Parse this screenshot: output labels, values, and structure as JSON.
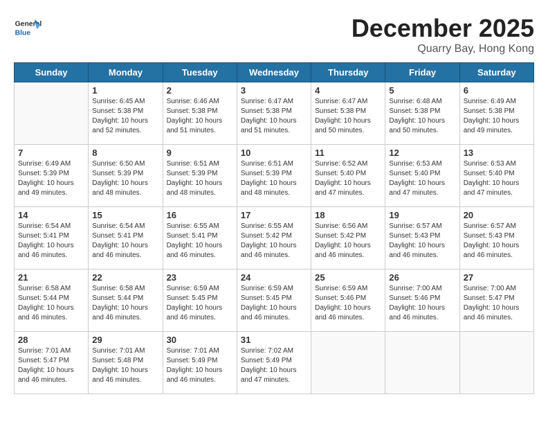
{
  "header": {
    "logo_general": "General",
    "logo_blue": "Blue",
    "month_title": "December 2025",
    "subtitle": "Quarry Bay, Hong Kong"
  },
  "weekdays": [
    "Sunday",
    "Monday",
    "Tuesday",
    "Wednesday",
    "Thursday",
    "Friday",
    "Saturday"
  ],
  "weeks": [
    [
      {
        "day": "",
        "empty": true
      },
      {
        "day": "1",
        "rise": "6:45 AM",
        "set": "5:38 PM",
        "daylight": "10 hours and 52 minutes."
      },
      {
        "day": "2",
        "rise": "6:46 AM",
        "set": "5:38 PM",
        "daylight": "10 hours and 51 minutes."
      },
      {
        "day": "3",
        "rise": "6:47 AM",
        "set": "5:38 PM",
        "daylight": "10 hours and 51 minutes."
      },
      {
        "day": "4",
        "rise": "6:47 AM",
        "set": "5:38 PM",
        "daylight": "10 hours and 50 minutes."
      },
      {
        "day": "5",
        "rise": "6:48 AM",
        "set": "5:38 PM",
        "daylight": "10 hours and 50 minutes."
      },
      {
        "day": "6",
        "rise": "6:49 AM",
        "set": "5:38 PM",
        "daylight": "10 hours and 49 minutes."
      }
    ],
    [
      {
        "day": "7",
        "rise": "6:49 AM",
        "set": "5:39 PM",
        "daylight": "10 hours and 49 minutes."
      },
      {
        "day": "8",
        "rise": "6:50 AM",
        "set": "5:39 PM",
        "daylight": "10 hours and 48 minutes."
      },
      {
        "day": "9",
        "rise": "6:51 AM",
        "set": "5:39 PM",
        "daylight": "10 hours and 48 minutes."
      },
      {
        "day": "10",
        "rise": "6:51 AM",
        "set": "5:39 PM",
        "daylight": "10 hours and 48 minutes."
      },
      {
        "day": "11",
        "rise": "6:52 AM",
        "set": "5:40 PM",
        "daylight": "10 hours and 47 minutes."
      },
      {
        "day": "12",
        "rise": "6:53 AM",
        "set": "5:40 PM",
        "daylight": "10 hours and 47 minutes."
      },
      {
        "day": "13",
        "rise": "6:53 AM",
        "set": "5:40 PM",
        "daylight": "10 hours and 47 minutes."
      }
    ],
    [
      {
        "day": "14",
        "rise": "6:54 AM",
        "set": "5:41 PM",
        "daylight": "10 hours and 46 minutes."
      },
      {
        "day": "15",
        "rise": "6:54 AM",
        "set": "5:41 PM",
        "daylight": "10 hours and 46 minutes."
      },
      {
        "day": "16",
        "rise": "6:55 AM",
        "set": "5:41 PM",
        "daylight": "10 hours and 46 minutes."
      },
      {
        "day": "17",
        "rise": "6:55 AM",
        "set": "5:42 PM",
        "daylight": "10 hours and 46 minutes."
      },
      {
        "day": "18",
        "rise": "6:56 AM",
        "set": "5:42 PM",
        "daylight": "10 hours and 46 minutes."
      },
      {
        "day": "19",
        "rise": "6:57 AM",
        "set": "5:43 PM",
        "daylight": "10 hours and 46 minutes."
      },
      {
        "day": "20",
        "rise": "6:57 AM",
        "set": "5:43 PM",
        "daylight": "10 hours and 46 minutes."
      }
    ],
    [
      {
        "day": "21",
        "rise": "6:58 AM",
        "set": "5:44 PM",
        "daylight": "10 hours and 46 minutes."
      },
      {
        "day": "22",
        "rise": "6:58 AM",
        "set": "5:44 PM",
        "daylight": "10 hours and 46 minutes."
      },
      {
        "day": "23",
        "rise": "6:59 AM",
        "set": "5:45 PM",
        "daylight": "10 hours and 46 minutes."
      },
      {
        "day": "24",
        "rise": "6:59 AM",
        "set": "5:45 PM",
        "daylight": "10 hours and 46 minutes."
      },
      {
        "day": "25",
        "rise": "6:59 AM",
        "set": "5:46 PM",
        "daylight": "10 hours and 46 minutes."
      },
      {
        "day": "26",
        "rise": "7:00 AM",
        "set": "5:46 PM",
        "daylight": "10 hours and 46 minutes."
      },
      {
        "day": "27",
        "rise": "7:00 AM",
        "set": "5:47 PM",
        "daylight": "10 hours and 46 minutes."
      }
    ],
    [
      {
        "day": "28",
        "rise": "7:01 AM",
        "set": "5:47 PM",
        "daylight": "10 hours and 46 minutes."
      },
      {
        "day": "29",
        "rise": "7:01 AM",
        "set": "5:48 PM",
        "daylight": "10 hours and 46 minutes."
      },
      {
        "day": "30",
        "rise": "7:01 AM",
        "set": "5:49 PM",
        "daylight": "10 hours and 46 minutes."
      },
      {
        "day": "31",
        "rise": "7:02 AM",
        "set": "5:49 PM",
        "daylight": "10 hours and 47 minutes."
      },
      {
        "day": "",
        "empty": true
      },
      {
        "day": "",
        "empty": true
      },
      {
        "day": "",
        "empty": true
      }
    ]
  ],
  "labels": {
    "sunrise": "Sunrise:",
    "sunset": "Sunset:",
    "daylight": "Daylight:"
  }
}
